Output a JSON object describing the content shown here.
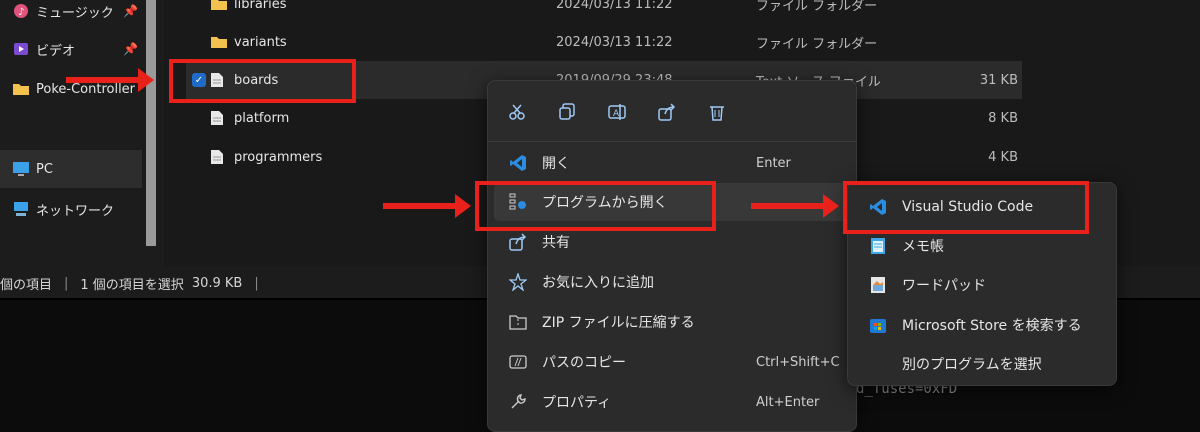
{
  "nav": {
    "items": [
      {
        "label": "ミュージック",
        "icon": "music-icon",
        "pinned": true
      },
      {
        "label": "ビデオ",
        "icon": "video-icon",
        "pinned": true
      },
      {
        "label": "Poke-Controller",
        "icon": "folder-icon",
        "pinned": false
      },
      {
        "label": "PC",
        "icon": "pc-icon",
        "pinned": false
      },
      {
        "label": "ネットワーク",
        "icon": "network-icon",
        "pinned": false
      }
    ]
  },
  "files": [
    {
      "name": "libraries",
      "date": "2024/03/13 11:22",
      "type": "ファイル フォルダー",
      "size": "",
      "kind": "folder"
    },
    {
      "name": "variants",
      "date": "2024/03/13 11:22",
      "type": "ファイル フォルダー",
      "size": "",
      "kind": "folder"
    },
    {
      "name": "boards",
      "date": "2019/09/29 23:48",
      "type": "Text ソース ファイル",
      "size": "31 KB",
      "kind": "file"
    },
    {
      "name": "platform",
      "date": "",
      "type": "ル",
      "size": "8 KB",
      "kind": "file"
    },
    {
      "name": "programmers",
      "date": "",
      "type": "ル",
      "size": "4 KB",
      "kind": "file"
    }
  ],
  "status": {
    "count": "個の項目",
    "selected": "1 個の項目を選択",
    "size": "30.9 KB"
  },
  "terminal": {
    "text": "d_fuses=0xFD"
  },
  "context_menu": {
    "toolbar": [
      "cut-icon",
      "copy-icon",
      "rename-icon",
      "share-icon",
      "delete-icon"
    ],
    "items": [
      {
        "label": "開く",
        "shortcut": "Enter",
        "icon": "vscode-icon"
      },
      {
        "label": "プログラムから開く",
        "shortcut": "",
        "icon": "open-with-icon",
        "submenu": true
      },
      {
        "label": "共有",
        "shortcut": "",
        "icon": "share-icon"
      },
      {
        "label": "お気に入りに追加",
        "shortcut": "",
        "icon": "star-icon"
      },
      {
        "label": "ZIP ファイルに圧縮する",
        "shortcut": "",
        "icon": "zip-icon"
      },
      {
        "label": "パスのコピー",
        "shortcut": "Ctrl+Shift+C",
        "icon": "copy-path-icon"
      },
      {
        "label": "プロパティ",
        "shortcut": "Alt+Enter",
        "icon": "wrench-icon"
      }
    ]
  },
  "submenu": {
    "items": [
      {
        "label": "Visual Studio Code",
        "icon": "vscode-icon"
      },
      {
        "label": "メモ帳",
        "icon": "notepad-icon"
      },
      {
        "label": "ワードパッド",
        "icon": "wordpad-icon"
      },
      {
        "label": "Microsoft Store を検索する",
        "icon": "store-icon"
      },
      {
        "label": "別のプログラムを選択",
        "icon": ""
      }
    ]
  },
  "colors": {
    "accent": "#1e6cc8",
    "annotation": "#e8221a",
    "vscode": "#2a8de0"
  }
}
